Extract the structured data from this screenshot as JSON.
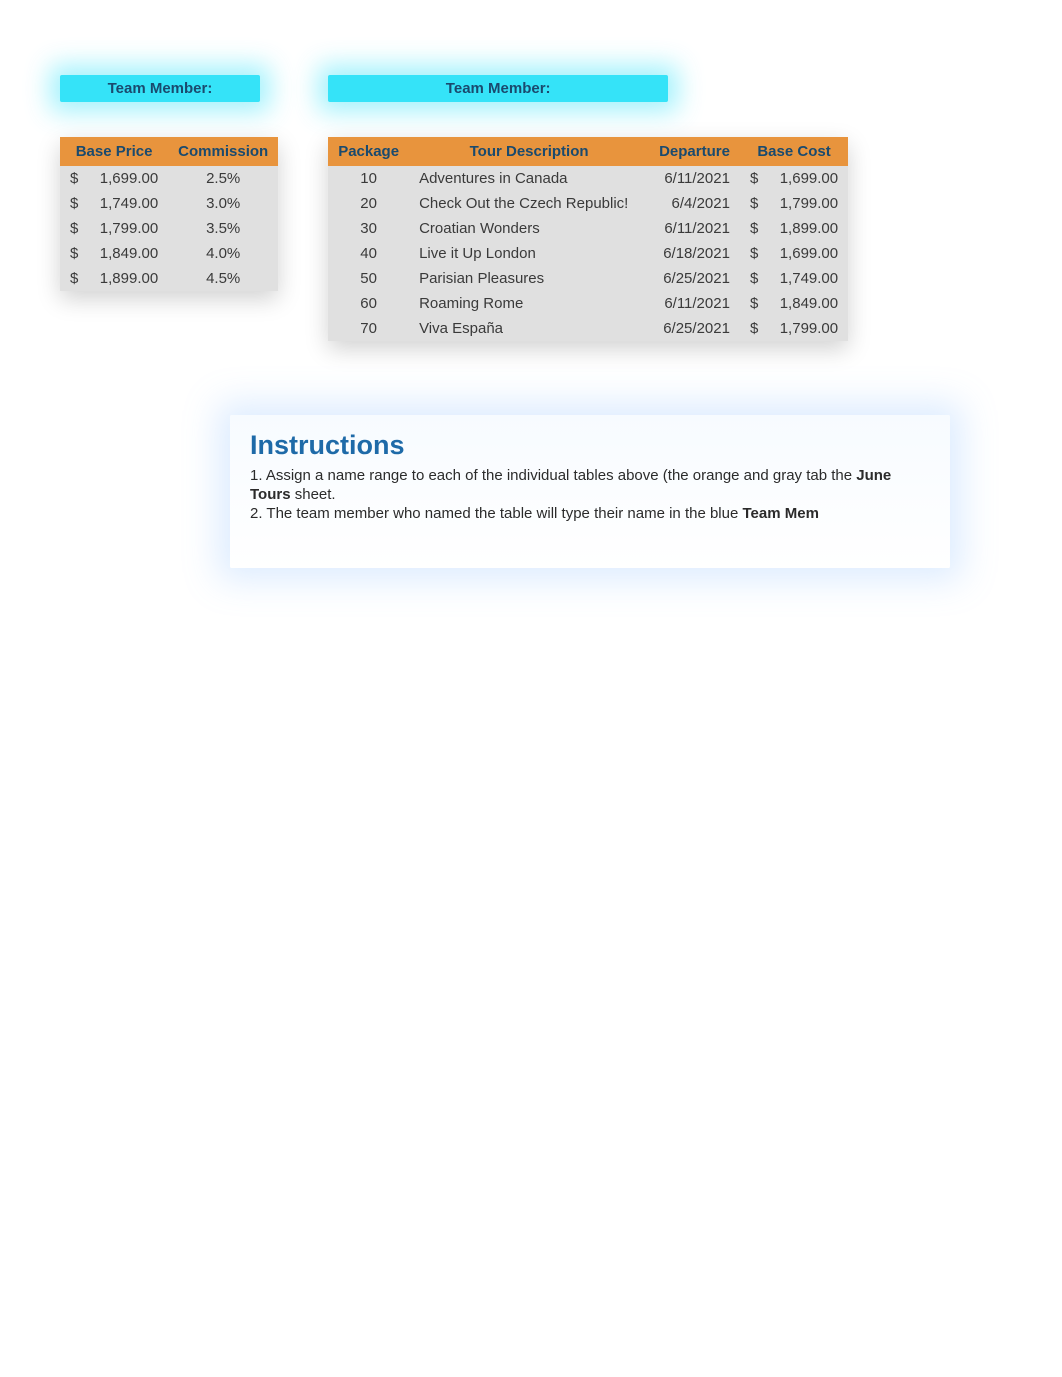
{
  "left_panel": {
    "team_label": "Team Member:",
    "headers": {
      "base_price": "Base Price",
      "commission": "Commission"
    },
    "rows": [
      {
        "price": "1,699.00",
        "commission": "2.5%"
      },
      {
        "price": "1,749.00",
        "commission": "3.0%"
      },
      {
        "price": "1,799.00",
        "commission": "3.5%"
      },
      {
        "price": "1,849.00",
        "commission": "4.0%"
      },
      {
        "price": "1,899.00",
        "commission": "4.5%"
      }
    ]
  },
  "right_panel": {
    "team_label": "Team Member:",
    "headers": {
      "package": "Package",
      "tour_desc": "Tour Description",
      "departure": "Departure",
      "base_cost": "Base Cost"
    },
    "rows": [
      {
        "package": "10",
        "desc": "Adventures in Canada",
        "departure": "6/11/2021",
        "cost": "1,699.00"
      },
      {
        "package": "20",
        "desc": "Check Out the Czech Republic!",
        "departure": "6/4/2021",
        "cost": "1,799.00"
      },
      {
        "package": "30",
        "desc": "Croatian Wonders",
        "departure": "6/11/2021",
        "cost": "1,899.00"
      },
      {
        "package": "40",
        "desc": "Live it Up London",
        "departure": "6/18/2021",
        "cost": "1,699.00"
      },
      {
        "package": "50",
        "desc": "Parisian Pleasures",
        "departure": "6/25/2021",
        "cost": "1,749.00"
      },
      {
        "package": "60",
        "desc": "Roaming  Rome",
        "departure": "6/11/2021",
        "cost": "1,849.00"
      },
      {
        "package": "70",
        "desc": "Viva España",
        "departure": "6/25/2021",
        "cost": "1,799.00"
      }
    ]
  },
  "instructions": {
    "title": "Instructions",
    "line1_pre": "1.  Assign a name range to each of the individual tables above (the orange and gray tab the ",
    "line1_bold": "June Tours",
    "line1_post": " sheet.",
    "line2_pre": "2.  The team member who named the table will type their name in the blue ",
    "line2_bold": "Team Mem"
  },
  "currency_symbol": "$"
}
